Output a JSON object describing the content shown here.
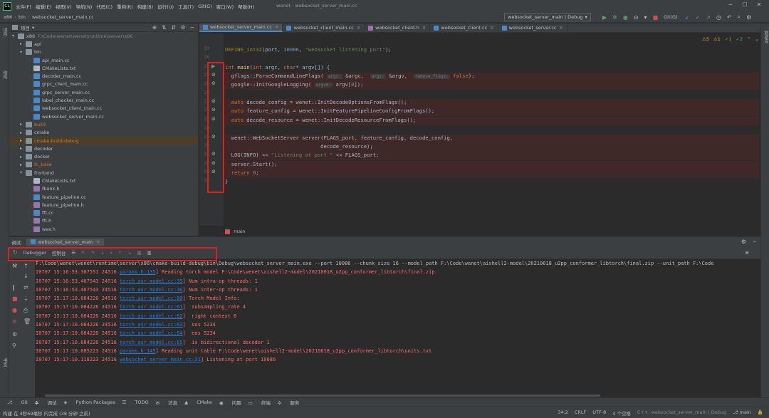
{
  "menubar": {
    "logo": "CL",
    "items": [
      "文件(F)",
      "编辑(E)",
      "视图(V)",
      "导航(N)",
      "代码(C)",
      "重构(R)",
      "构建(B)",
      "运行(U)",
      "工具(T)",
      "Git(G)",
      "窗口(W)",
      "帮助(H)"
    ],
    "window_title": "wenet - websocket_server_main.cc"
  },
  "navbar": {
    "crumbs": [
      "x86",
      "bin",
      "websocket_server_main.cc"
    ],
    "run_config": "websocket_server_main | Debug",
    "git_label": "Git(G):"
  },
  "leftstrip": {
    "labels": [
      "项目",
      "结构",
      "书签"
    ]
  },
  "project": {
    "header": "项目",
    "rows": [
      {
        "indent": 0,
        "arrow": "▾",
        "type": "folder",
        "name": "x86",
        "extra": "F:\\Code\\wenet\\wenet\\runtime\\server\\x86",
        "selected": false
      },
      {
        "indent": 1,
        "arrow": "▸",
        "type": "folder",
        "name": "api",
        "extra": "",
        "selected": false
      },
      {
        "indent": 1,
        "arrow": "▾",
        "type": "folder",
        "name": "bin",
        "extra": "",
        "selected": false
      },
      {
        "indent": 2,
        "arrow": "",
        "type": "cpp",
        "name": "api_main.cc",
        "extra": "",
        "selected": false
      },
      {
        "indent": 2,
        "arrow": "",
        "type": "txt",
        "name": "CMakeLists.txt",
        "extra": "",
        "selected": false
      },
      {
        "indent": 2,
        "arrow": "",
        "type": "cpp",
        "name": "decoder_main.cc",
        "extra": "",
        "selected": false
      },
      {
        "indent": 2,
        "arrow": "",
        "type": "cpp",
        "name": "grpc_client_main.cc",
        "extra": "",
        "selected": false
      },
      {
        "indent": 2,
        "arrow": "",
        "type": "cpp",
        "name": "grpc_server_main.cc",
        "extra": "",
        "selected": false
      },
      {
        "indent": 2,
        "arrow": "",
        "type": "cpp",
        "name": "label_checker_main.cc",
        "extra": "",
        "selected": false
      },
      {
        "indent": 2,
        "arrow": "",
        "type": "cpp",
        "name": "websocket_client_main.cc",
        "extra": "",
        "selected": false
      },
      {
        "indent": 2,
        "arrow": "",
        "type": "cpp",
        "name": "websocket_server_main.cc",
        "extra": "",
        "selected": false
      },
      {
        "indent": 1,
        "arrow": "▸",
        "type": "folder",
        "name": "build",
        "extra": "",
        "selected": false,
        "color": "orange"
      },
      {
        "indent": 1,
        "arrow": "▸",
        "type": "folder",
        "name": "cmake",
        "extra": "",
        "selected": false
      },
      {
        "indent": 1,
        "arrow": "▸",
        "type": "folder",
        "name": "cmake-build-debug",
        "extra": "",
        "selected": true,
        "color": "orange"
      },
      {
        "indent": 1,
        "arrow": "▸",
        "type": "folder",
        "name": "decoder",
        "extra": "",
        "selected": false
      },
      {
        "indent": 1,
        "arrow": "▸",
        "type": "folder",
        "name": "docker",
        "extra": "",
        "selected": false
      },
      {
        "indent": 1,
        "arrow": "▸",
        "type": "folder",
        "name": "fc_base",
        "extra": "",
        "selected": false,
        "color": "orange"
      },
      {
        "indent": 1,
        "arrow": "▾",
        "type": "folder",
        "name": "frontend",
        "extra": "",
        "selected": false
      },
      {
        "indent": 2,
        "arrow": "",
        "type": "txt",
        "name": "CMakeLists.txt",
        "extra": "",
        "selected": false
      },
      {
        "indent": 2,
        "arrow": "",
        "type": "h",
        "name": "fbank.h",
        "extra": "",
        "selected": false
      },
      {
        "indent": 2,
        "arrow": "",
        "type": "cpp",
        "name": "feature_pipeline.cc",
        "extra": "",
        "selected": false
      },
      {
        "indent": 2,
        "arrow": "",
        "type": "h",
        "name": "feature_pipeline.h",
        "extra": "",
        "selected": false
      },
      {
        "indent": 2,
        "arrow": "",
        "type": "cpp",
        "name": "fft.cc",
        "extra": "",
        "selected": false
      },
      {
        "indent": 2,
        "arrow": "",
        "type": "h",
        "name": "fft.h",
        "extra": "",
        "selected": false
      },
      {
        "indent": 2,
        "arrow": "",
        "type": "h",
        "name": "wav.h",
        "extra": "",
        "selected": false
      }
    ]
  },
  "editor": {
    "tabs": [
      {
        "name": "websocket_server_main.cc",
        "kind": "cpp",
        "active": true
      },
      {
        "name": "websocket_client_main.cc",
        "kind": "cpp",
        "active": false
      },
      {
        "name": "websocket_client.h",
        "kind": "h",
        "active": false
      },
      {
        "name": "websocket_client.cc",
        "kind": "cpp",
        "active": false
      },
      {
        "name": "websocket_server.cc",
        "kind": "cpp",
        "active": false
      }
    ],
    "inspections": [
      "⚠5",
      "⚠1",
      "✓1",
      "✓2",
      "⌃",
      "⌄"
    ],
    "breadcrumb": "main",
    "lines": [
      {
        "n": "19",
        "mark": "",
        "err": false,
        "html": "<span class='mac'>DEFINE_int32</span>(port, <span class='num'>10086</span>, <span class='str'>\"websocket listening port\"</span>);"
      },
      {
        "n": "20",
        "mark": "",
        "err": false,
        "html": ""
      },
      {
        "n": "21",
        "mark": "▶",
        "err": false,
        "html": "<span class='kw'>int</span> <span class='fn'>main</span>(<span class='kw'>int</span> argc, <span class='kw'>char</span>* argv[]) {"
      },
      {
        "n": "22",
        "mark": "⊘",
        "err": true,
        "html": "  gflags::ParseCommandLineFlags( <span class='param'>argc:</span> &amp;argc,  <span class='param'>argv:</span> &amp;argv,  <span class='param'>remove_flags:</span> <span class='kw'>false</span>);"
      },
      {
        "n": "23",
        "mark": "⊘",
        "err": true,
        "html": "  google::InitGoogleLogging( <span class='param'>argv0:</span> argv[<span class='num'>0</span>]);"
      },
      {
        "n": "24",
        "mark": "",
        "err": false,
        "html": ""
      },
      {
        "n": "25",
        "mark": "⊘",
        "err": true,
        "html": "  <span class='kw'>auto</span> decode_config = wenet::InitDecodeOptionsFromFlags();"
      },
      {
        "n": "26",
        "mark": "⊘",
        "err": true,
        "html": "  <span class='kw'>auto</span> feature_config = wenet::InitFeaturePipelineConfigFromFlags();"
      },
      {
        "n": "27",
        "mark": "⊘",
        "err": true,
        "html": "  <span class='kw'>auto</span> decode_resource = wenet::InitDecodeResourceFromFlags();"
      },
      {
        "n": "28",
        "mark": "",
        "err": false,
        "html": ""
      },
      {
        "n": "29",
        "mark": "⊘",
        "err": true,
        "html": "  wenet::WebSocketServer server(FLAGS_port, feature_config, decode_config,"
      },
      {
        "n": "30",
        "mark": "",
        "err": true,
        "html": "                               decode_resource);"
      },
      {
        "n": "31",
        "mark": "⊘",
        "err": true,
        "html": "  LOG(INFO) &lt;&lt; <span class='str'>\"Listening at port \"</span> &lt;&lt; FLAGS_port;"
      },
      {
        "n": "32",
        "mark": "⊘",
        "err": true,
        "html": "  server.Start();"
      },
      {
        "n": "33",
        "mark": "⊘",
        "err": true,
        "html": "  <span class='kw'>return</span> <span class='num'>0</span>;"
      },
      {
        "n": "34",
        "mark": "",
        "err": false,
        "html": "}"
      }
    ]
  },
  "debug": {
    "panel_label": "调试:",
    "session": "websocket_server_main",
    "tab_debugger": "Debugger",
    "tab_console": "控制台",
    "console_lines": [
      {
        "first": true,
        "html": "F:\\Code\\wenet\\wenet\\runtime\\server\\x86\\cmake-build-debug\\bin\\Debug\\websocket_server_main.exe --port 10086 --chunk_size 16 --model_path F:\\Code\\wenet\\aishell2-model\\20210618_u2pp_conformer_libtorch\\final.zip --unit_path F:\\Code"
      },
      {
        "first": false,
        "html": "I0707 15:16:53.307551 24516 <span class='link'>params.h:135</span>] Reading torch model F:\\Code\\wenet\\aishell2-model\\20210618_u2pp_conformer_libtorch\\final.zip"
      },
      {
        "first": false,
        "html": "I0707 15:16:53.407543 24516 <span class='link'>torch_asr_model.cc:35</span>] Num intra-op threads: 1"
      },
      {
        "first": false,
        "html": "I0707 15:16:53.407543 24516 <span class='link'>torch_asr_model.cc:36</span>] Num inter-op threads: 1"
      },
      {
        "first": false,
        "html": "I0707 15:17:10.084226 24516 <span class='link'>torch_asr_model.cc:60</span>] Torch Model Info:"
      },
      {
        "first": false,
        "html": "I0707 15:17:10.084226 24516 <span class='link'>torch_asr_model.cc:61</span>]  subsampling_rate 4"
      },
      {
        "first": false,
        "html": "I0707 15:17:10.084226 24516 <span class='link'>torch_asr_model.cc:62</span>]  right context 6"
      },
      {
        "first": false,
        "html": "I0707 15:17:10.084226 24516 <span class='link'>torch_asr_model.cc:63</span>]  sos 5234"
      },
      {
        "first": false,
        "html": "I0707 15:17:10.084226 24516 <span class='link'>torch_asr_model.cc:64</span>]  eos 5234"
      },
      {
        "first": false,
        "html": "I0707 15:17:10.084226 24516 <span class='link'>torch_asr_model.cc:65</span>]  is bidirectional decoder 1"
      },
      {
        "first": false,
        "html": "I0707 15:17:10.085223 24516 <span class='link'>params.h:145</span>] Reading unit table F:\\Code\\wenet\\aishell2-model\\20210618_u2pp_conformer_libtorch\\units.txt"
      },
      {
        "first": false,
        "html": "I0707 15:17:10.118223 24516 <span class='link'>websocket_server_main.cc:31</span>] Listening at port 10086"
      }
    ]
  },
  "bottom_tabs": [
    "Git",
    "调试",
    "Python Packages",
    "TODO",
    "消息",
    "CMake",
    "问题",
    "终端",
    "服务"
  ],
  "statusbar": {
    "left": "构建 在 4秒69毫秒 内完成 (38 分钟 之前)",
    "position": "34:2",
    "line_ending": "CRLF",
    "encoding": "UTF-8",
    "indent": "4 个空格",
    "context": "C++: websocket_server_main | Debug",
    "branch": "main"
  },
  "colors": {
    "error_border": "#e0201c",
    "accent": "#4a88c7"
  }
}
